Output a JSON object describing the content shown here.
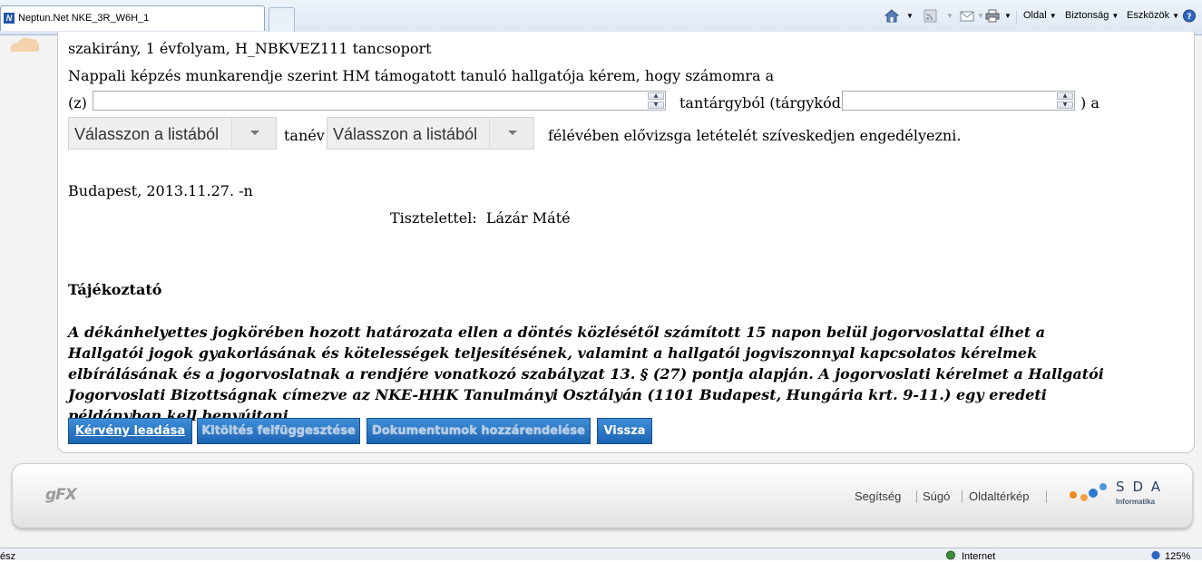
{
  "browser": {
    "tab_title": "Neptun.Net NKE_3R_W6H_1",
    "tab_favicon": "N",
    "commands": {
      "page": "Oldal",
      "safety": "Biztonság",
      "tools": "Eszközök"
    },
    "icons": [
      "home-icon",
      "rss-icon",
      "mail-icon",
      "print-icon",
      "help-icon"
    ]
  },
  "form": {
    "line1": "szakirány, 1 évfolyam, H_NBKVEZ111 tancsoport",
    "line2": "Nappali képzés munkarendje szerint HM támogatott tanuló hallgatója kérem, hogy számomra a",
    "prefix_z": "(z)",
    "subject_field_value": "",
    "subject_suffix": "tantárgyból (tárgykód:",
    "code_field_value": "",
    "code_suffix": ") a",
    "year_select": "Válasszon a listából",
    "year_label": "tanév",
    "semester_select": "Válasszon a listából",
    "semester_suffix": "félévében elővizsga letételét szíveskedjen engedélyezni.",
    "place_date": "Budapest, 2013.11.27. -n",
    "regards_label": "Tisztelettel:",
    "signer": "Lázár Máté"
  },
  "notice": {
    "title": "Tájékoztató",
    "body": "A dékánhelyettes jogkörében hozott határozata ellen a döntés közlésétől számított 15 napon belül jogorvoslattal élhet a Hallgatói jogok gyakorlásának és kötelességek teljesítésének, valamint a hallgatói jogviszonnyal kapcsolatos kérelmek elbírálásának és a jogorvoslatnak a rendjére vonatkozó szabályzat 13. § (27) pontja alapján. A jogorvoslati kérelmet a Hallgatói Jogorvoslati Bizottságnak címezve az NKE-HHK Tanulmányi Osztályán (1101 Budapest, Hungária krt. 9-11.) egy eredeti példányban kell benyújtani."
  },
  "buttons": {
    "submit": "Kérvény leadása",
    "suspend": "Kitöltés felfüggesztése",
    "attach": "Dokumentumok hozzárendelése",
    "back": "Vissza"
  },
  "footer": {
    "gfx_logo": "gFX",
    "links": [
      "Segítség",
      "Súgó",
      "Oldaltérkép"
    ],
    "sda_logo": "SDA",
    "sda_sub": "Informatika"
  },
  "statusbar": {
    "left": "ész",
    "zone": "Internet",
    "zoom": "125%"
  },
  "colors": {
    "button_blue": "#2a74c4",
    "link_gray": "#3a3a3a",
    "sda_blue": "#2a3d6b",
    "sda_orange": "#f08a1c"
  }
}
